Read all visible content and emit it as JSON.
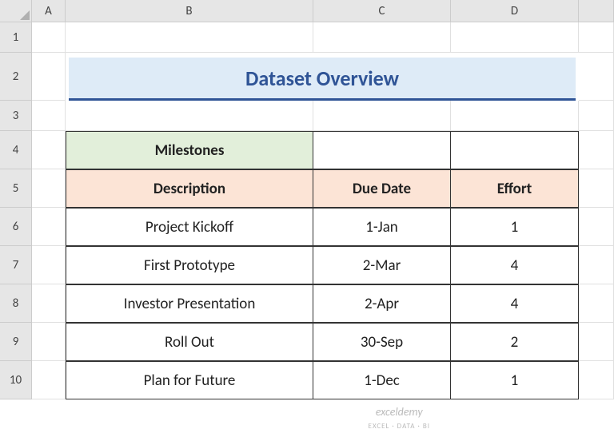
{
  "columns": [
    "A",
    "B",
    "C",
    "D"
  ],
  "rows": [
    "1",
    "2",
    "3",
    "4",
    "5",
    "6",
    "7",
    "8",
    "9",
    "10"
  ],
  "title": "Dataset Overview",
  "headers": {
    "milestones": "Milestones",
    "description": "Description",
    "due_date": "Due Date",
    "effort": "Effort"
  },
  "data": [
    {
      "description": "Project Kickoff",
      "due_date": "1-Jan",
      "effort": "1"
    },
    {
      "description": "First Prototype",
      "due_date": "2-Mar",
      "effort": "4"
    },
    {
      "description": "Investor Presentation",
      "due_date": "2-Apr",
      "effort": "4"
    },
    {
      "description": "Roll  Out",
      "due_date": "30-Sep",
      "effort": "2"
    },
    {
      "description": "Plan for Future",
      "due_date": "1-Dec",
      "effort": "1"
    }
  ],
  "watermark": {
    "main": "exceldemy",
    "sub": "EXCEL · DATA · BI"
  },
  "chart_data": {
    "type": "table",
    "title": "Dataset Overview",
    "columns": [
      "Description",
      "Due Date",
      "Effort"
    ],
    "rows": [
      [
        "Project Kickoff",
        "1-Jan",
        1
      ],
      [
        "First Prototype",
        "2-Mar",
        4
      ],
      [
        "Investor Presentation",
        "2-Apr",
        4
      ],
      [
        "Roll  Out",
        "30-Sep",
        2
      ],
      [
        "Plan for Future",
        "1-Dec",
        1
      ]
    ]
  }
}
